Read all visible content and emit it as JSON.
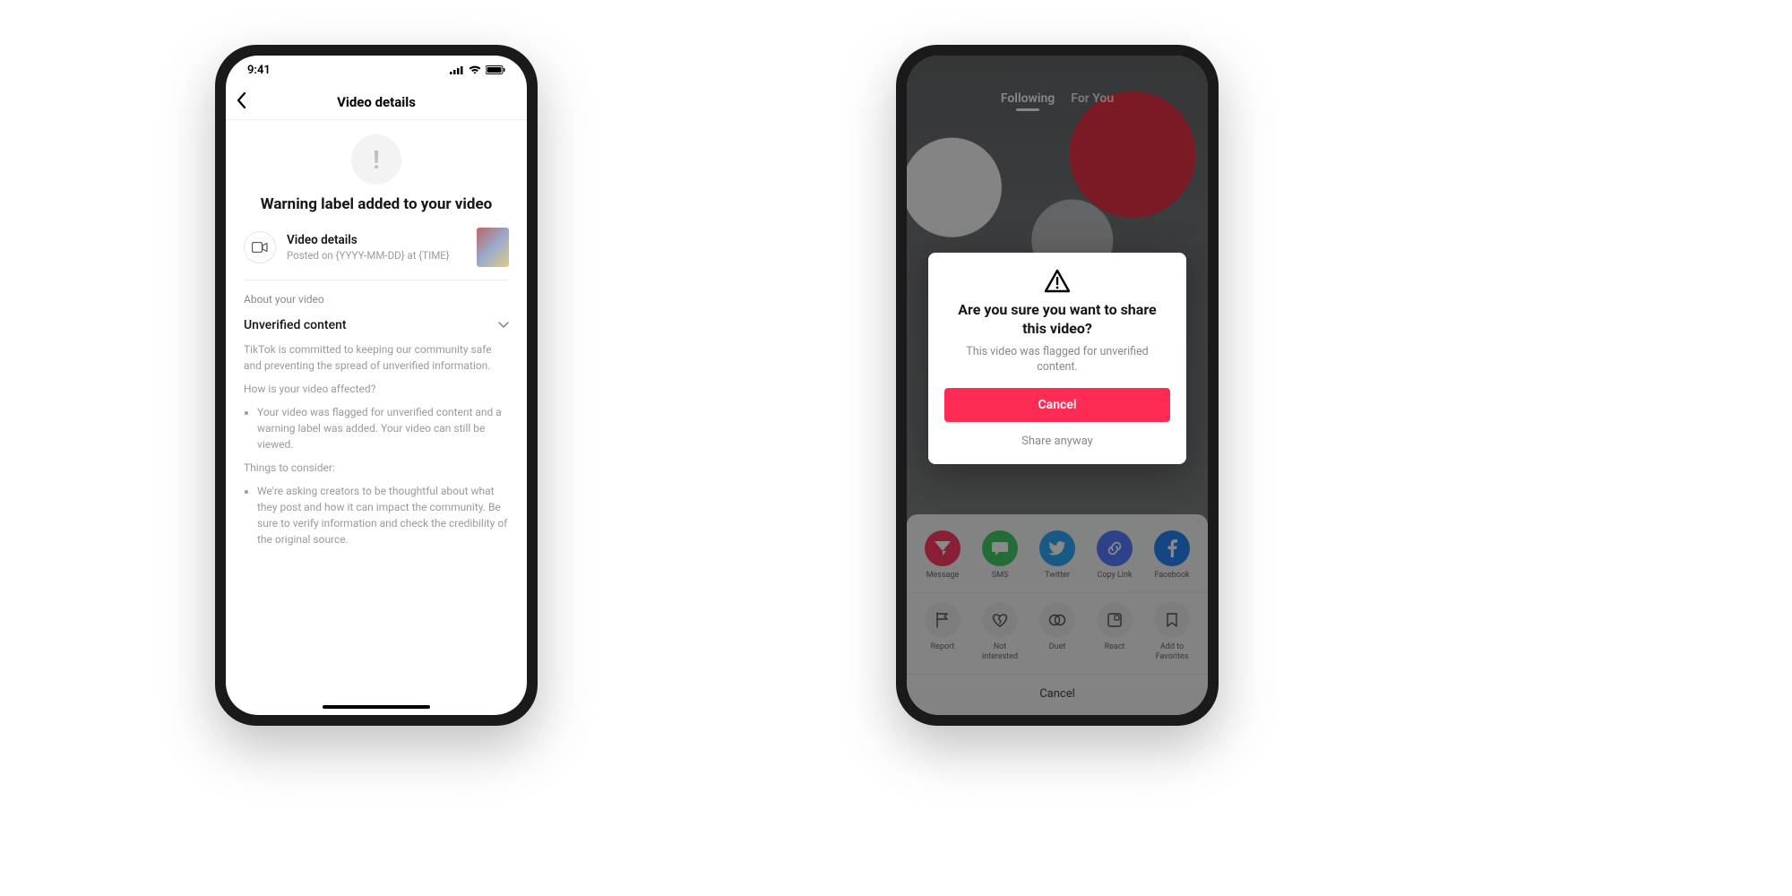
{
  "left": {
    "status_time": "9:41",
    "nav_title": "Video details",
    "warn_title": "Warning label added to your video",
    "video": {
      "title": "Video details",
      "subtitle": "Posted on {YYYY-MM-DD} at {TIME}"
    },
    "section_label": "About your video",
    "expand_label": "Unverified content",
    "body": {
      "intro": "TikTok is committed to keeping our community safe and preventing the spread of unverified information.",
      "q1": "How is your video affected?",
      "b1": "Your video was flagged for unverified content and a warning label was added. Your video can still be viewed.",
      "q2": "Things to consider:",
      "b2": "We're asking creators to be thoughtful about what they post and how it can impact the community. Be sure to verify information and check the credibility of the original source."
    }
  },
  "right": {
    "tabs": {
      "following": "Following",
      "for_you": "For You"
    },
    "modal": {
      "title": "Are you sure you want to share this video?",
      "subtitle": "This video was flagged for unverified content.",
      "cancel": "Cancel",
      "secondary": "Share anyway"
    },
    "share": {
      "row1": {
        "message": "Message",
        "sms": "SMS",
        "twitter": "Twitter",
        "copy": "Copy Link",
        "facebook": "Facebook"
      },
      "row2": {
        "report": "Report",
        "not_interested": "Not interested",
        "duet": "Duet",
        "react": "React",
        "favorites": "Add to Favorites"
      },
      "cancel": "Cancel"
    }
  }
}
